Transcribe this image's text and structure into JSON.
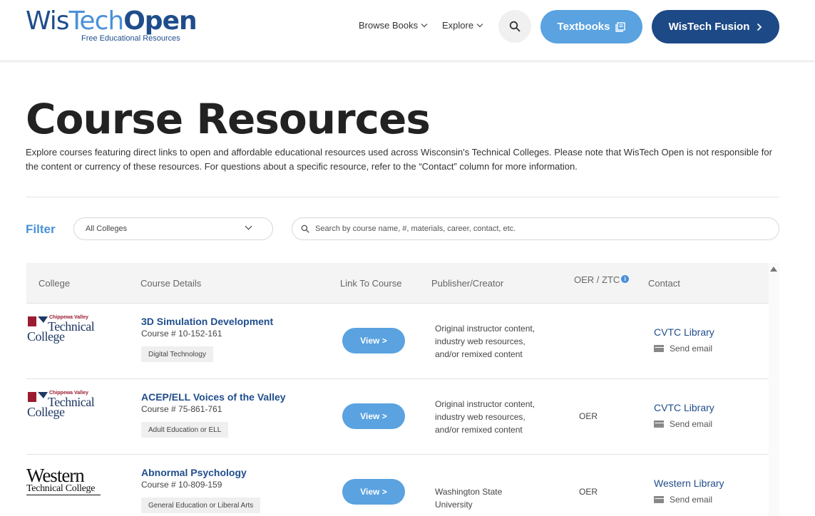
{
  "header": {
    "logo": {
      "wis": "Wis",
      "tech": "Tech",
      "open": "Open",
      "tagline": "Free Educational   Resources"
    },
    "nav": [
      {
        "label": "Browse Books"
      },
      {
        "label": "Explore"
      }
    ],
    "textbooks_label": "Textbooks",
    "fusion_label": "WisTech Fusion"
  },
  "main": {
    "title": "Course Resources",
    "intro": "Explore courses featuring direct links to open and affordable educational resources used across Wisconsin's Technical Colleges. Please note that WisTech Open is not responsible for the content or currency of these resources. For questions about a specific resource, refer to the “Contact” column for more information."
  },
  "filter": {
    "label": "Filter",
    "college_selected": "All Colleges",
    "search_placeholder": "Search by course name, #, materials, career, contact, etc."
  },
  "table": {
    "columns": [
      "College",
      "Course Details",
      "Link To Course",
      "Publisher/Creator",
      "OER / ZTC",
      "Contact"
    ],
    "rows": [
      {
        "college_logo": {
          "top": "Chippewa Valley",
          "line1": "Technical",
          "line2": "College"
        },
        "course_name": "3D Simulation Development",
        "course_number": "Course # 10-152-161",
        "category": "Digital Technology",
        "link_label": "View >",
        "publisher": "Original instructor content, industry web resources, and/or remixed content",
        "oer": "",
        "contact": "CVTC Library",
        "email_label": "Send email"
      },
      {
        "college_logo": {
          "top": "Chippewa Valley",
          "line1": "Technical",
          "line2": "College"
        },
        "course_name": "ACEP/ELL Voices of the Valley",
        "course_number": "Course # 75-861-761",
        "category": "Adult Education or ELL",
        "link_label": "View >",
        "publisher": "Original instructor content, industry web resources, and/or remixed content",
        "oer": "OER",
        "contact": "CVTC Library",
        "email_label": "Send email"
      },
      {
        "college_logo": {
          "line1": "Western",
          "line2": "Technical College"
        },
        "course_name": "Abnormal Psychology",
        "course_number": "Course # 10-809-159",
        "category": "General Education or Liberal Arts",
        "link_label": "View >",
        "publisher": "Washington State University",
        "oer": "OER",
        "contact": "Western Library",
        "email_label": "Send email"
      }
    ]
  },
  "colors": {
    "brand_dark": "#1d4a86",
    "brand_light": "#5aa2e0",
    "cvtc_red": "#9b1b30"
  }
}
